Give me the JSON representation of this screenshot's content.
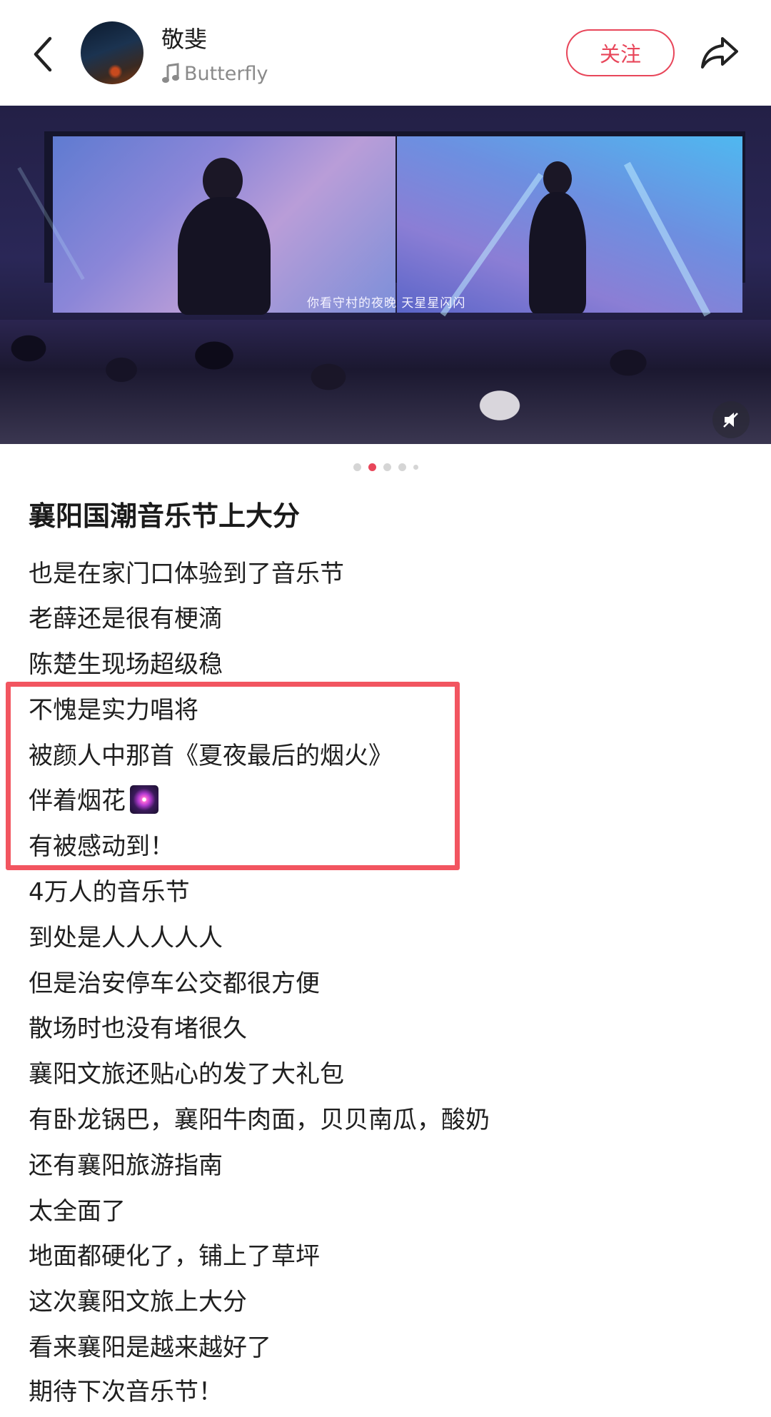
{
  "header": {
    "username": "敬斐",
    "music_title": "Butterfly",
    "follow_label": "关注"
  },
  "media": {
    "caption": "你看守村的夜晚 天星星闪闪",
    "pagination": {
      "total": 5,
      "current": 2
    }
  },
  "post": {
    "title": "襄阳国潮音乐节上大分",
    "lines": [
      "也是在家门口体验到了音乐节",
      "老薛还是很有梗滴",
      "陈楚生现场超级稳",
      "不愧是实力唱将",
      "被颜人中那首《夏夜最后的烟火》",
      "伴着烟花",
      "有被感动到！",
      "4万人的音乐节",
      "到处是人人人人人",
      "但是治安停车公交都很方便",
      "散场时也没有堵很久",
      "襄阳文旅还贴心的发了大礼包",
      "有卧龙锅巴，襄阳牛肉面，贝贝南瓜，酸奶",
      "还有襄阳旅游指南",
      "太全面了",
      "地面都硬化了，铺上了草坪",
      "这次襄阳文旅上大分",
      "看来襄阳是越来越好了",
      "期待下次音乐节！"
    ],
    "emoji_after_line_6": "firework-icon"
  },
  "colors": {
    "accent": "#e8465a",
    "highlight_border": "#f25560",
    "text": "#1f1f1f",
    "secondary_text": "#8a8a8a"
  }
}
